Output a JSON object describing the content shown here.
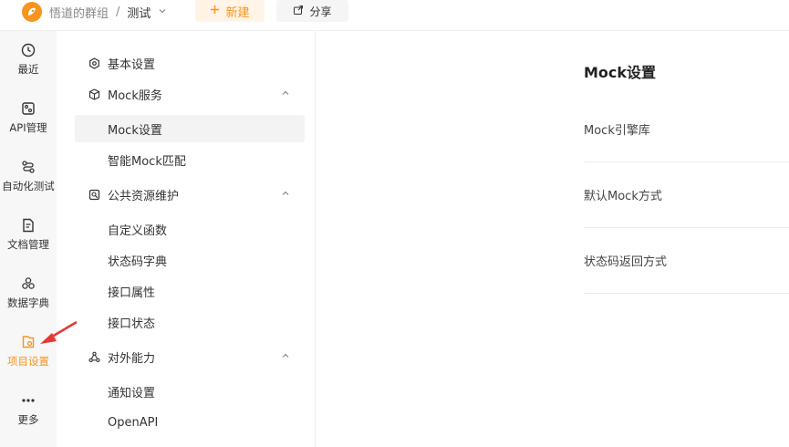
{
  "topbar": {
    "breadcrumb_group": "悟道的群组",
    "breadcrumb_sep": "/",
    "breadcrumb_project": "测试",
    "new_label": "新建",
    "share_label": "分享"
  },
  "rail": {
    "items": [
      {
        "label": "最近",
        "icon": "history-icon"
      },
      {
        "label": "API管理",
        "icon": "api-icon"
      },
      {
        "label": "自动化测试",
        "icon": "flow-icon"
      },
      {
        "label": "文档管理",
        "icon": "document-icon"
      },
      {
        "label": "数据字典",
        "icon": "dictionary-icon"
      },
      {
        "label": "项目设置",
        "icon": "project-settings-icon",
        "active": true
      },
      {
        "label": "更多",
        "icon": "more-icon"
      }
    ]
  },
  "subnav": {
    "basic": "基本设置",
    "mock_service": "Mock服务",
    "mock_settings": "Mock设置",
    "smart_mock": "智能Mock匹配",
    "public_resources": "公共资源维护",
    "custom_functions": "自定义函数",
    "status_codes": "状态码字典",
    "api_attributes": "接口属性",
    "api_status": "接口状态",
    "external": "对外能力",
    "notify": "通知设置",
    "openapi": "OpenAPI"
  },
  "main": {
    "title": "Mock设置",
    "rows": [
      "Mock引擎库",
      "默认Mock方式",
      "状态码返回方式"
    ]
  },
  "colors": {
    "accent": "#f7941d",
    "annotation_arrow": "#e53935"
  }
}
